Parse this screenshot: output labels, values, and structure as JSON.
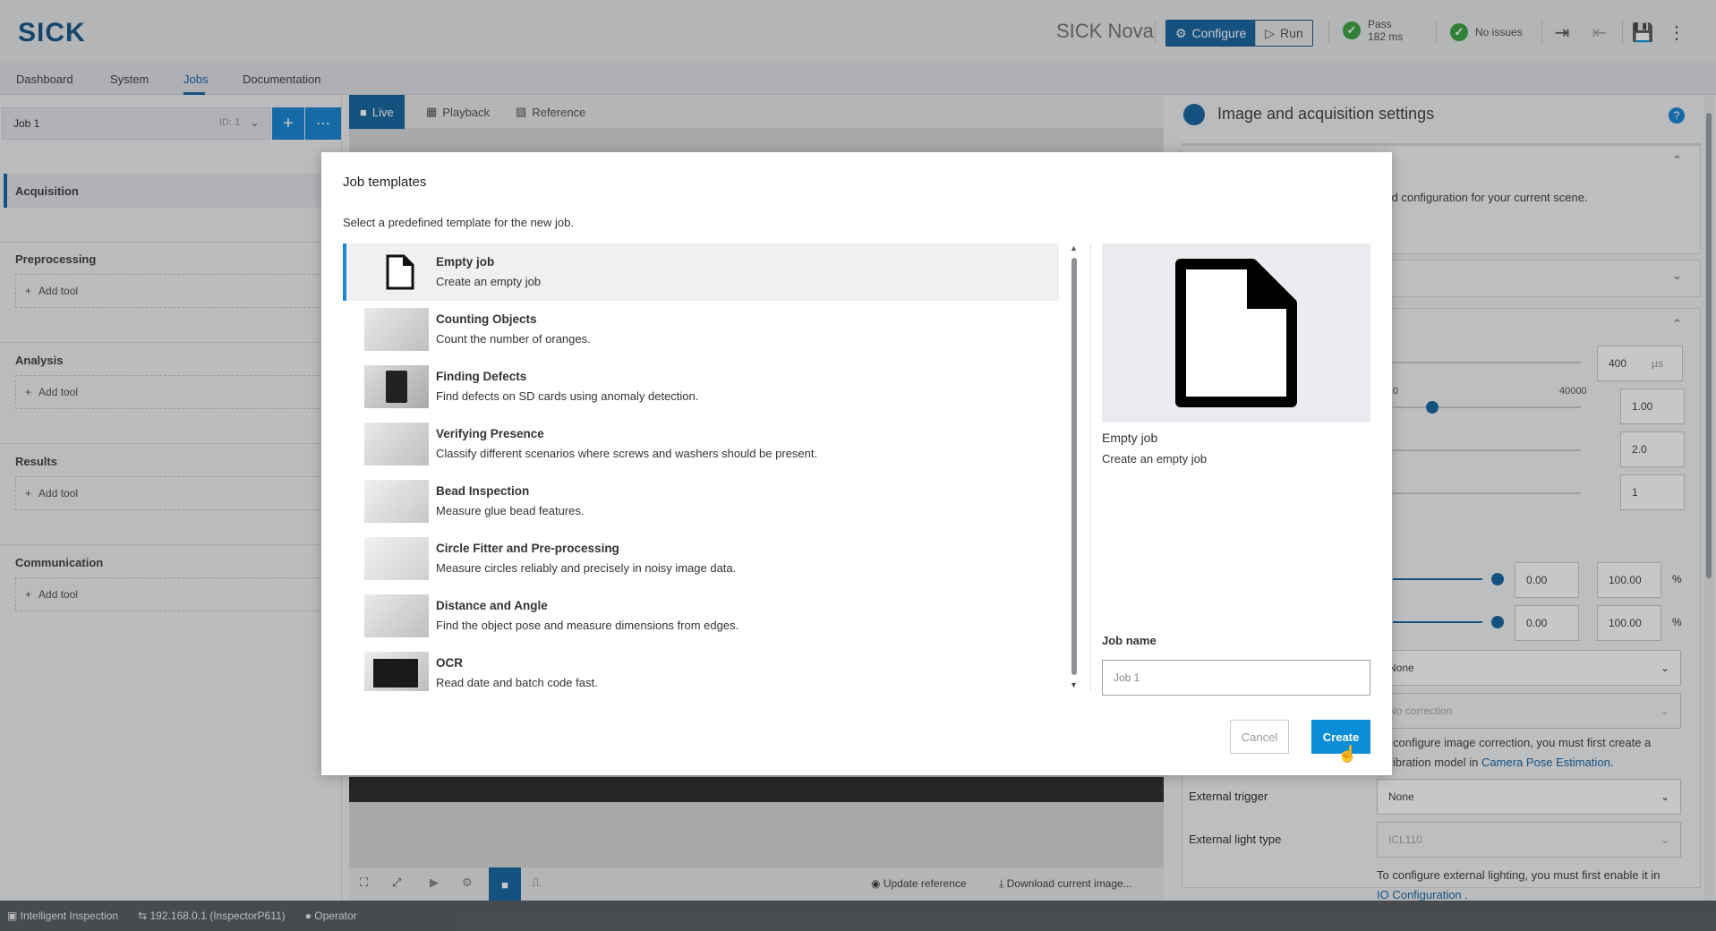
{
  "header": {
    "logo": "SICK",
    "product": "SICK Nova",
    "configure_label": "Configure",
    "run_label": "Run",
    "result_label": "Pass",
    "result_time": "182 ms",
    "issues_label": "No issues"
  },
  "nav": {
    "tabs": [
      {
        "label": "Dashboard"
      },
      {
        "label": "System"
      },
      {
        "label": "Jobs"
      },
      {
        "label": "Documentation"
      }
    ],
    "active": "Jobs"
  },
  "left": {
    "job_name": "Job 1",
    "job_id": "ID: 1",
    "sections": [
      {
        "title": "Acquisition"
      },
      {
        "title": "Preprocessing",
        "add": "Add tool"
      },
      {
        "title": "Analysis",
        "add": "Add tool"
      },
      {
        "title": "Results",
        "add": "Add tool"
      },
      {
        "title": "Communication",
        "add": "Add tool"
      }
    ]
  },
  "center": {
    "tabs": [
      {
        "label": "Live"
      },
      {
        "label": "Playback"
      },
      {
        "label": "Reference"
      }
    ],
    "update_reference": "Update reference",
    "download_image": "Download current image..."
  },
  "right": {
    "title": "Image and acquisition settings",
    "partial_text": "cled configuration for your current scene.",
    "exposure_value": "400",
    "exposure_unit": "µs",
    "range_min": "0",
    "range_max": "40000",
    "gain_value": "1.00",
    "gamma_value": "2.0",
    "binning_value": "1",
    "range1_min": "0.00",
    "range1_max": "100.00",
    "range2_min": "0.00",
    "range2_max": "100.00",
    "percent": "%",
    "select_none": "None",
    "correction": "No correction",
    "correction_note_1": "configure image correction, you must first create a",
    "correction_note_2": "ibration model in",
    "correction_link": "Camera Pose Estimation",
    "external_trigger_label": "External trigger",
    "external_trigger_value": "None",
    "external_light_label": "External light type",
    "external_light_value": "ICL110",
    "lighting_note": "To configure external lighting, you must first enable it in",
    "lighting_link": "IO Configuration",
    "period": "."
  },
  "statusbar": {
    "app": "Intelligent Inspection",
    "device": "192.168.0.1 (InspectorP611)",
    "user": "Operator"
  },
  "modal": {
    "title": "Job templates",
    "subtitle": "Select a predefined template for the new job.",
    "templates": [
      {
        "name": "Empty job",
        "desc": "Create an empty job"
      },
      {
        "name": "Counting Objects",
        "desc": "Count the number of oranges."
      },
      {
        "name": "Finding Defects",
        "desc": "Find defects on SD cards using anomaly detection."
      },
      {
        "name": "Verifying Presence",
        "desc": "Classify different scenarios where screws and washers should be present."
      },
      {
        "name": "Bead Inspection",
        "desc": "Measure glue bead features."
      },
      {
        "name": "Circle Fitter and Pre-processing",
        "desc": "Measure circles reliably and precisely in noisy image data."
      },
      {
        "name": "Distance and Angle",
        "desc": "Find the object pose and measure dimensions from edges."
      },
      {
        "name": "OCR",
        "desc": "Read date and batch code fast."
      }
    ],
    "selected_name": "Empty job",
    "selected_desc": "Create an empty job",
    "job_name_label": "Job name",
    "job_name_placeholder": "Job 1",
    "cancel_label": "Cancel",
    "create_label": "Create"
  }
}
